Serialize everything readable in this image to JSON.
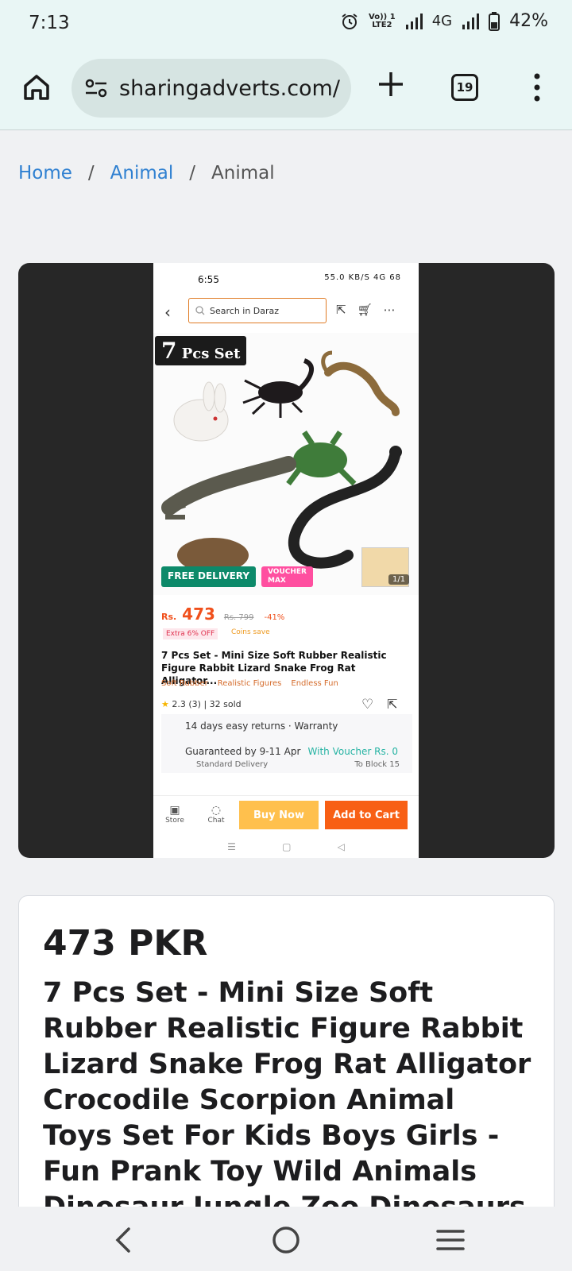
{
  "status_bar": {
    "time": "7:13",
    "volte": "Vo)) 1",
    "lte": "LTE2",
    "network": "4G",
    "battery": "42%"
  },
  "toolbar": {
    "url": "sharingadverts.com/",
    "tab_count": "19"
  },
  "breadcrumb": {
    "items": [
      "Home",
      "Animal",
      "Animal"
    ],
    "separator": "/"
  },
  "screenshot": {
    "time": "6:55",
    "status_right": "55.0 KB/S 4G 68",
    "search_placeholder": "Search in Daraz",
    "badge_number": "7",
    "badge_text": "Pcs Set",
    "free_delivery": "FREE DELIVERY",
    "voucher_line1": "VOUCHER",
    "voucher_line2": "MAX",
    "image_count": "1/1",
    "price_prefix": "Rs.",
    "price": "473",
    "old_price": "Rs. 799",
    "discount": "-41%",
    "extra_off": "Extra 6% OFF",
    "coins": "Coins save",
    "title": "7 Pcs Set - Mini Size Soft Rubber Realistic Figure Rabbit Lizard Snake Frog Rat Alligator...",
    "tags": [
      "Soft Rubber",
      "Realistic Figures",
      "Endless Fun"
    ],
    "rating": "2.3 (3)",
    "sold": "32 sold",
    "returns": "14 days easy returns · Warranty",
    "guaranteed": "Guaranteed by 9-11 Apr",
    "voucher_text": "With Voucher Rs. 0",
    "standard_delivery": "Standard Delivery",
    "to_block": "To Block 15",
    "store": "Store",
    "chat": "Chat",
    "buy_now": "Buy Now",
    "add_to_cart": "Add to Cart"
  },
  "product": {
    "price": "473 PKR",
    "title": "7 Pcs Set - Mini Size Soft Rubber Realistic Figure Rabbit Lizard Snake Frog Rat Alligator Crocodile Scorpion Animal Toys Set For Kids Boys Girls - Fun Prank Toy Wild Animals Dinosaur Jungle Zoo Dinosaurs"
  },
  "colors": {
    "link": "#2f80d1",
    "daraz_orange": "#f85f14",
    "buy_now": "#ffc04d",
    "free_delivery": "#0d8a6a"
  }
}
